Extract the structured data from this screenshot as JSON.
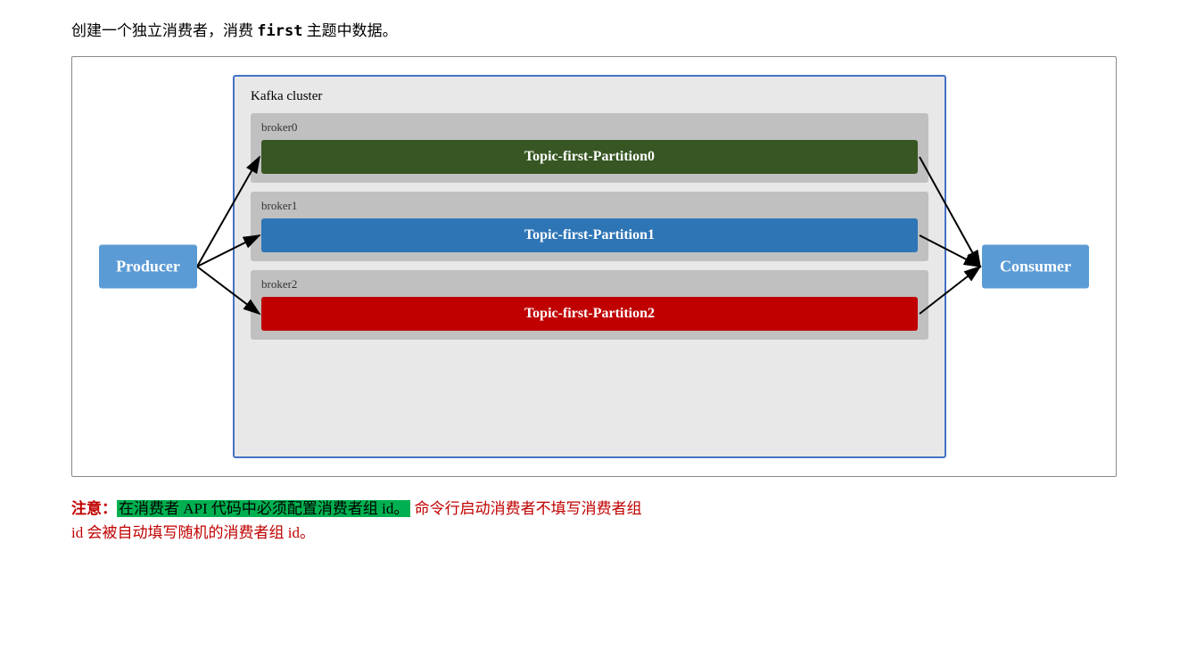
{
  "intro": {
    "text": "创建一个独立消费者，消费 first 主题中数据。",
    "code_word": "first"
  },
  "diagram": {
    "kafka_cluster_label": "Kafka cluster",
    "producer_label": "Producer",
    "consumer_label": "Consumer",
    "brokers": [
      {
        "label": "broker0",
        "partition_label": "Topic-first-Partition0",
        "color_class": "partition-green"
      },
      {
        "label": "broker1",
        "partition_label": "Topic-first-Partition1",
        "color_class": "partition-blue"
      },
      {
        "label": "broker2",
        "partition_label": "Topic-first-Partition2",
        "color_class": "partition-red"
      }
    ]
  },
  "note": {
    "bold_prefix": "注意：",
    "highlight_text": "在消费者 API 代码中必须配置消费者组 id。",
    "rest_line1": " 命令行启动消费者不填写消费者组",
    "line2": "id 会被自动填写随机的消费者组 id。"
  }
}
